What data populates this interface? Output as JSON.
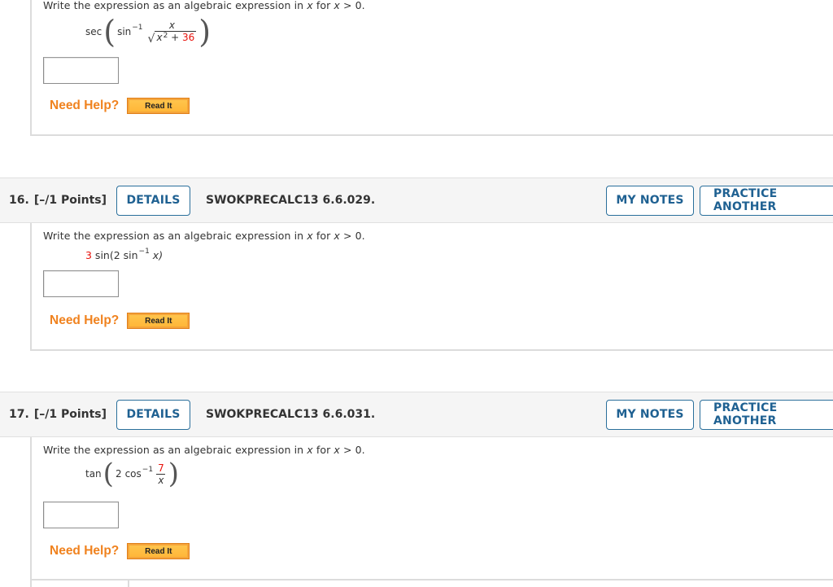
{
  "common": {
    "prompt_prefix": "Write the expression as an algebraic expression in ",
    "prompt_var": "x",
    "prompt_mid": " for ",
    "prompt_var2": "x",
    "prompt_suffix": " > 0.",
    "need_help": "Need Help?",
    "read_it": "Read It",
    "details": "DETAILS",
    "my_notes": "MY NOTES",
    "practice_another": "PRACTICE ANOTHER"
  },
  "questions": [
    {
      "expression": {
        "outer_fn": "sec",
        "inner_fn": "sin",
        "inverse_exp": "−1",
        "numerator": "x",
        "denominator_var": "x",
        "denominator_exp": "2",
        "denominator_op": " + ",
        "denominator_const": "36"
      },
      "answer_value": ""
    },
    {
      "number": "16.",
      "points": "[–/1 Points]",
      "code": "SWOKPRECALC13 6.6.029.",
      "expression": {
        "coef": "3",
        "text_a": " sin(2 sin",
        "inverse_exp": "−1",
        "text_b": " x)"
      },
      "answer_value": ""
    },
    {
      "number": "17.",
      "points": "[–/1 Points]",
      "code": "SWOKPRECALC13 6.6.031.",
      "expression": {
        "outer_fn": "tan",
        "coef": "2",
        "inner_fn": "cos",
        "inverse_exp": "−1",
        "numerator": "7",
        "denominator": "x"
      },
      "answer_value": ""
    }
  ],
  "colors": {
    "accent_blue": "#1f6192",
    "help_orange": "#f0821e",
    "highlight_red": "#e8120c"
  }
}
